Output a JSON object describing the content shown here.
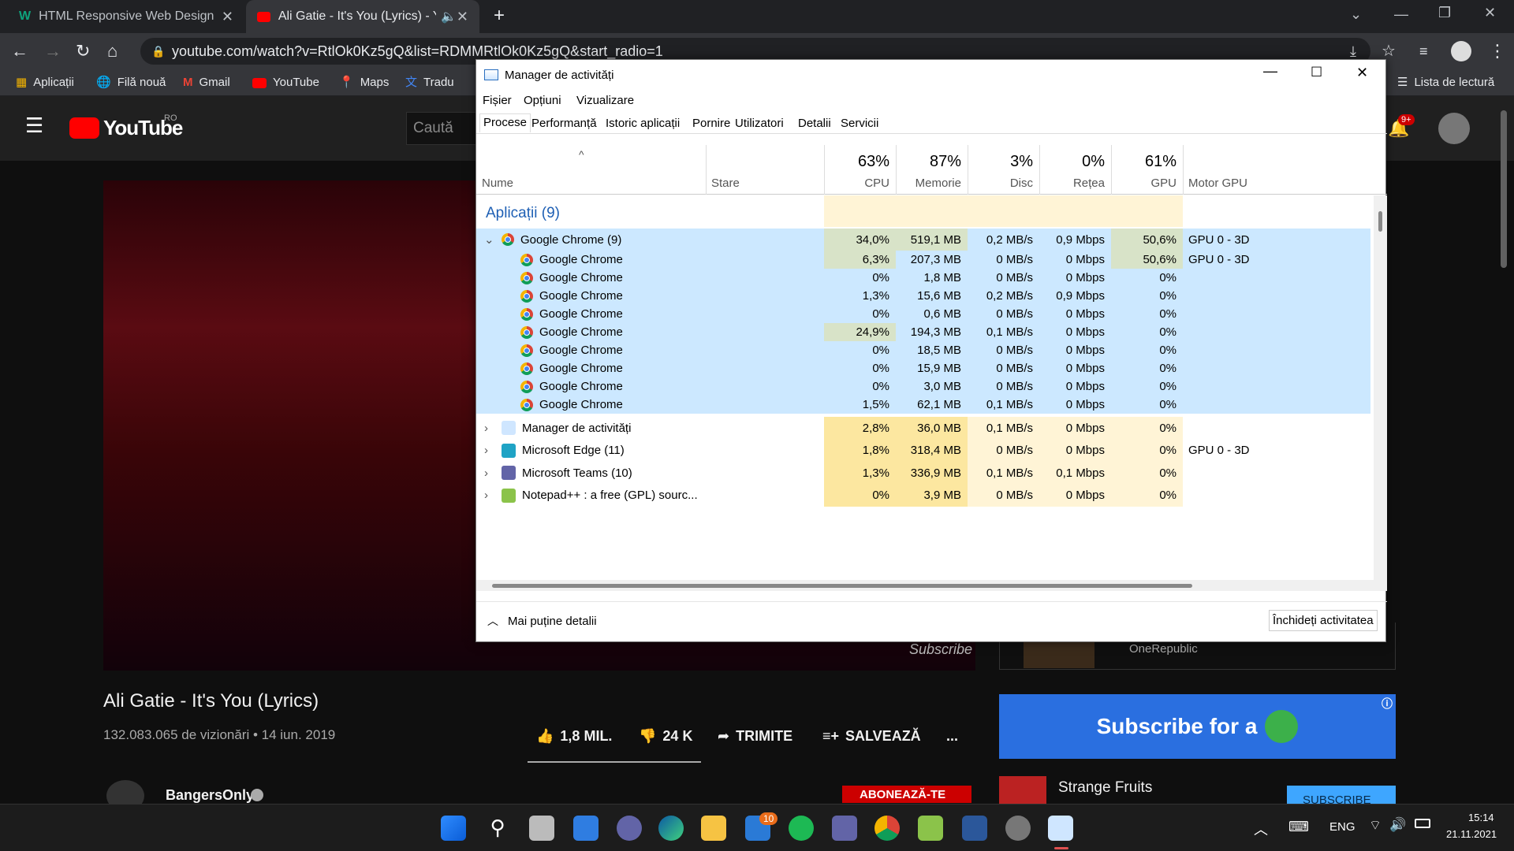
{
  "browser": {
    "tabs": [
      {
        "title": "HTML Responsive Web Design",
        "icon": "w-icon"
      },
      {
        "title": "Ali Gatie - It's You (Lyrics) - Yo",
        "icon": "youtube-icon"
      }
    ],
    "new_tab_label": "+",
    "url": "youtube.com/watch?v=RtlOk0Kz5gQ&list=RDMMRtlOk0Kz5gQ&start_radio=1",
    "bookmarks": [
      "Aplicații",
      "Filă nouă",
      "Gmail",
      "YouTube",
      "Maps",
      "Tradu"
    ],
    "reading_list": "Lista de lectură"
  },
  "youtube": {
    "logo": "YouTube",
    "region": "RO",
    "search_placeholder": "Caută",
    "notifications": "9+",
    "video_title": "Ali Gatie - It's You (Lyrics)",
    "video_meta": "132.083.065 de vizionări • 14 iun. 2019",
    "likes": "1,8 MIL.",
    "dislikes": "24 K",
    "share": "TRIMITE",
    "save": "SALVEAZĂ",
    "more": "...",
    "channel": "BangersOnly",
    "subscribe": "ABONEAZĂ-TE",
    "watermark": "Subscribe",
    "ad_text": "Subscribe for a",
    "rec_title": "Strange Fruits",
    "rec_subscribe": "SUBSCRIBE",
    "above_rec_channel": "OneRepublic"
  },
  "taskmgr": {
    "title": "Manager de activități",
    "menu": [
      "Fișier",
      "Opțiuni",
      "Vizualizare"
    ],
    "tabs": [
      "Procese",
      "Performanță",
      "Istoric aplicații",
      "Pornire",
      "Utilizatori",
      "Detalii",
      "Servicii"
    ],
    "columns": {
      "name": "Nume",
      "status": "Stare",
      "cpu_pct": "63%",
      "cpu": "CPU",
      "mem_pct": "87%",
      "mem": "Memorie",
      "disk_pct": "3%",
      "disk": "Disc",
      "net_pct": "0%",
      "net": "Rețea",
      "gpu_pct": "61%",
      "gpu": "GPU",
      "gpu_engine": "Motor GPU"
    },
    "group_title": "Aplicații (9)",
    "rows": [
      {
        "name": "Google Chrome (9)",
        "cpu": "34,0%",
        "mem": "519,1 MB",
        "disk": "0,2 MB/s",
        "net": "0,9 Mbps",
        "gpu": "50,6%",
        "engine": "GPU 0 - 3D"
      },
      {
        "name": "Google Chrome",
        "cpu": "6,3%",
        "mem": "207,3 MB",
        "disk": "0 MB/s",
        "net": "0 Mbps",
        "gpu": "50,6%",
        "engine": "GPU 0 - 3D"
      },
      {
        "name": "Google Chrome",
        "cpu": "0%",
        "mem": "1,8 MB",
        "disk": "0 MB/s",
        "net": "0 Mbps",
        "gpu": "0%",
        "engine": ""
      },
      {
        "name": "Google Chrome",
        "cpu": "1,3%",
        "mem": "15,6 MB",
        "disk": "0,2 MB/s",
        "net": "0,9 Mbps",
        "gpu": "0%",
        "engine": ""
      },
      {
        "name": "Google Chrome",
        "cpu": "0%",
        "mem": "0,6 MB",
        "disk": "0 MB/s",
        "net": "0 Mbps",
        "gpu": "0%",
        "engine": ""
      },
      {
        "name": "Google Chrome",
        "cpu": "24,9%",
        "mem": "194,3 MB",
        "disk": "0,1 MB/s",
        "net": "0 Mbps",
        "gpu": "0%",
        "engine": ""
      },
      {
        "name": "Google Chrome",
        "cpu": "0%",
        "mem": "18,5 MB",
        "disk": "0 MB/s",
        "net": "0 Mbps",
        "gpu": "0%",
        "engine": ""
      },
      {
        "name": "Google Chrome",
        "cpu": "0%",
        "mem": "15,9 MB",
        "disk": "0 MB/s",
        "net": "0 Mbps",
        "gpu": "0%",
        "engine": ""
      },
      {
        "name": "Google Chrome",
        "cpu": "0%",
        "mem": "3,0 MB",
        "disk": "0 MB/s",
        "net": "0 Mbps",
        "gpu": "0%",
        "engine": ""
      },
      {
        "name": "Google Chrome",
        "cpu": "1,5%",
        "mem": "62,1 MB",
        "disk": "0,1 MB/s",
        "net": "0 Mbps",
        "gpu": "0%",
        "engine": ""
      },
      {
        "name": "Manager de activități",
        "cpu": "2,8%",
        "mem": "36,0 MB",
        "disk": "0,1 MB/s",
        "net": "0 Mbps",
        "gpu": "0%",
        "engine": ""
      },
      {
        "name": "Microsoft Edge (11)",
        "cpu": "1,8%",
        "mem": "318,4 MB",
        "disk": "0 MB/s",
        "net": "0 Mbps",
        "gpu": "0%",
        "engine": "GPU 0 - 3D"
      },
      {
        "name": "Microsoft Teams (10)",
        "cpu": "1,3%",
        "mem": "336,9 MB",
        "disk": "0,1 MB/s",
        "net": "0,1 Mbps",
        "gpu": "0%",
        "engine": ""
      },
      {
        "name": "Notepad++ : a free (GPL) sourc...",
        "cpu": "0%",
        "mem": "3,9 MB",
        "disk": "0 MB/s",
        "net": "0 Mbps",
        "gpu": "0%",
        "engine": ""
      }
    ],
    "fewer_details": "Mai puține detalii",
    "end_task": "Închideți activitatea"
  },
  "taskbar": {
    "mail_badge": "10",
    "language": "ENG",
    "time": "15:14",
    "date": "21.11.2021"
  },
  "colors": {
    "cpu_high": "#fce7a0",
    "cpu_low": "#fff4d6",
    "chrome_group": "#cce8ff"
  }
}
